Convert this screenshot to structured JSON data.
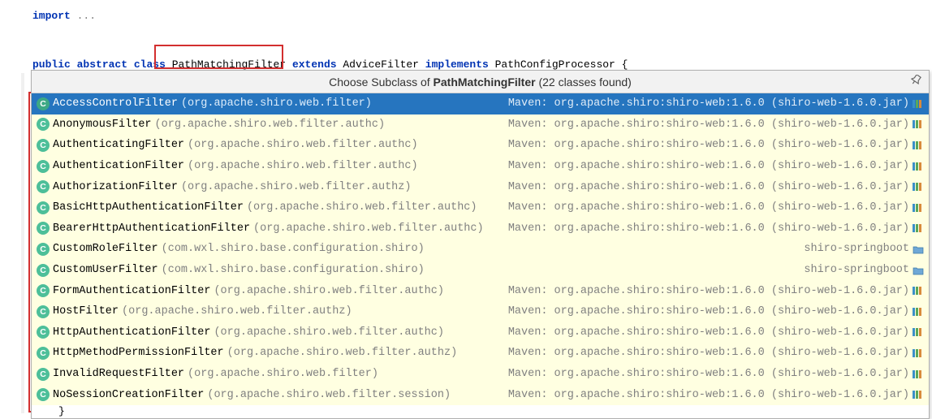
{
  "code": {
    "import_kw": "import",
    "import_rest": " ...",
    "decl_public": "public",
    "decl_abstract": "abstract",
    "decl_class": "class",
    "decl_name": "PathMatchingFilter",
    "decl_extends": "extends",
    "decl_parent": "AdviceFilter",
    "decl_implements": "implements",
    "decl_iface": "PathConfigProcessor",
    "decl_brace": " {",
    "end_brace": "}"
  },
  "popup": {
    "title_prefix": "Choose Subclass of ",
    "title_class": "PathMatchingFilter",
    "title_suffix": " (22 classes found)"
  },
  "maven_loc": "Maven: org.apache.shiro:shiro-web:1.6.0 (shiro-web-1.6.0.jar)",
  "module_loc": "shiro-springboot",
  "rows": [
    {
      "name": "AccessControlFilter",
      "pkg": "(org.apache.shiro.web.filter)",
      "loc": "maven",
      "sel": true
    },
    {
      "name": "AnonymousFilter",
      "pkg": "(org.apache.shiro.web.filter.authc)",
      "loc": "maven"
    },
    {
      "name": "AuthenticatingFilter",
      "pkg": "(org.apache.shiro.web.filter.authc)",
      "loc": "maven"
    },
    {
      "name": "AuthenticationFilter",
      "pkg": "(org.apache.shiro.web.filter.authc)",
      "loc": "maven"
    },
    {
      "name": "AuthorizationFilter",
      "pkg": "(org.apache.shiro.web.filter.authz)",
      "loc": "maven"
    },
    {
      "name": "BasicHttpAuthenticationFilter",
      "pkg": "(org.apache.shiro.web.filter.authc)",
      "loc": "maven"
    },
    {
      "name": "BearerHttpAuthenticationFilter",
      "pkg": "(org.apache.shiro.web.filter.authc)",
      "loc": "maven"
    },
    {
      "name": "CustomRoleFilter",
      "pkg": "(com.wxl.shiro.base.configuration.shiro)",
      "loc": "module"
    },
    {
      "name": "CustomUserFilter",
      "pkg": "(com.wxl.shiro.base.configuration.shiro)",
      "loc": "module"
    },
    {
      "name": "FormAuthenticationFilter",
      "pkg": "(org.apache.shiro.web.filter.authc)",
      "loc": "maven"
    },
    {
      "name": "HostFilter",
      "pkg": "(org.apache.shiro.web.filter.authz)",
      "loc": "maven"
    },
    {
      "name": "HttpAuthenticationFilter",
      "pkg": "(org.apache.shiro.web.filter.authc)",
      "loc": "maven"
    },
    {
      "name": "HttpMethodPermissionFilter",
      "pkg": "(org.apache.shiro.web.filter.authz)",
      "loc": "maven"
    },
    {
      "name": "InvalidRequestFilter",
      "pkg": "(org.apache.shiro.web.filter)",
      "loc": "maven"
    },
    {
      "name": "NoSessionCreationFilter",
      "pkg": "(org.apache.shiro.web.filter.session)",
      "loc": "maven"
    }
  ]
}
